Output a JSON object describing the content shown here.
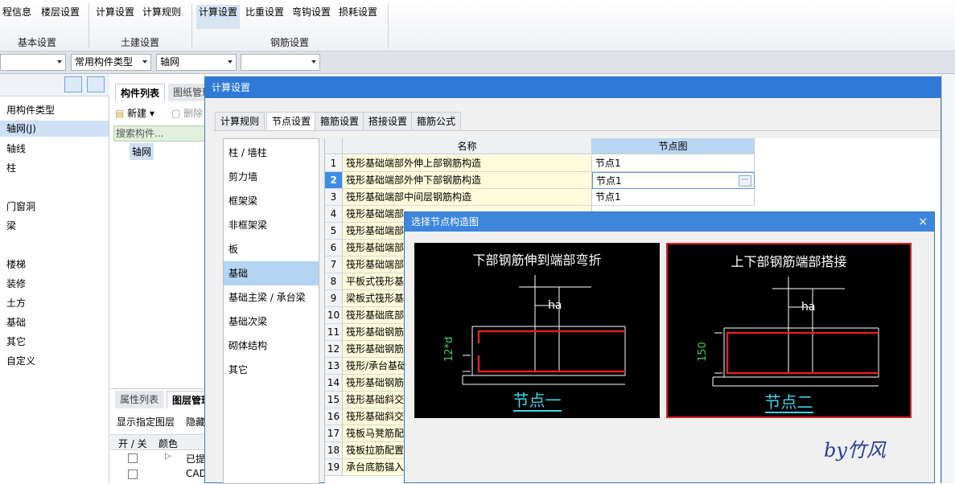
{
  "ribbon": {
    "tabs": [
      "程信息",
      "楼层设置",
      "计算设置",
      "计算规则",
      "计算设置",
      "比重设置",
      "弯钩设置",
      "损耗设置"
    ],
    "groups": [
      "基本设置",
      "土建设置",
      "钢筋设置"
    ]
  },
  "combos": [
    {
      "value": ""
    },
    {
      "value": "常用构件类型"
    },
    {
      "value": "轴网"
    },
    {
      "value": ""
    }
  ],
  "left_tree": {
    "items": [
      "用构件类型",
      "轴网(J)",
      "轴线",
      "柱",
      "门窗洞",
      "梁",
      "楼梯",
      "装修",
      "土方",
      "基础",
      "其它",
      "自定义"
    ],
    "selected_index": 1
  },
  "mid_panel": {
    "tabs": [
      "构件列表",
      "图纸管理"
    ],
    "new_label": "新建",
    "delete_label": "删除",
    "search_placeholder": "搜索构件...",
    "item": "轴网",
    "bottom_tabs": [
      "属性列表",
      "图层管理"
    ],
    "show_layer": "显示指定图层",
    "hide_label": "隐藏",
    "col_onoff": "开 / 关",
    "col_color": "颜色",
    "row1": "已提",
    "row2": "CAD"
  },
  "dialog": {
    "title": "计算设置",
    "tabs": [
      "计算规则",
      "节点设置",
      "箍筋设置",
      "搭接设置",
      "箍筋公式"
    ],
    "active_tab": 1,
    "categories": [
      "柱 / 墙柱",
      "剪力墙",
      "框架梁",
      "非框架梁",
      "板",
      "基础",
      "基础主梁 / 承台梁",
      "基础次梁",
      "砌体结构",
      "其它"
    ],
    "selected_category": 5,
    "grid": {
      "col_name": "名称",
      "col_node": "节点图",
      "rows": [
        {
          "n": "1",
          "name": "筏形基础端部外伸上部钢筋构造",
          "val": "节点1"
        },
        {
          "n": "2",
          "name": "筏形基础端部外伸下部钢筋构造",
          "val": "节点1"
        },
        {
          "n": "3",
          "name": "筏形基础端部中间层钢筋构造",
          "val": "节点1"
        },
        {
          "n": "4",
          "name": "筏形基础端部",
          "val": ""
        },
        {
          "n": "5",
          "name": "筏形基础端部",
          "val": ""
        },
        {
          "n": "6",
          "name": "筏形基础端部",
          "val": ""
        },
        {
          "n": "7",
          "name": "筏形基础端部",
          "val": ""
        },
        {
          "n": "8",
          "name": "平板式筏形基",
          "val": ""
        },
        {
          "n": "9",
          "name": "梁板式筏形基",
          "val": ""
        },
        {
          "n": "10",
          "name": "筏形基础底部",
          "val": ""
        },
        {
          "n": "11",
          "name": "筏形基础钢筋",
          "val": ""
        },
        {
          "n": "12",
          "name": "筏形基础钢筋",
          "val": ""
        },
        {
          "n": "13",
          "name": "筏形/承台基础",
          "val": ""
        },
        {
          "n": "14",
          "name": "筏形基础钢筋",
          "val": ""
        },
        {
          "n": "15",
          "name": "筏形基础斜交",
          "val": ""
        },
        {
          "n": "16",
          "name": "筏形基础斜交",
          "val": ""
        },
        {
          "n": "17",
          "name": "筏板马凳筋配",
          "val": ""
        },
        {
          "n": "18",
          "name": "筏板拉筋配置",
          "val": ""
        },
        {
          "n": "19",
          "name": "承台底筋锚入",
          "val": ""
        }
      ],
      "selected_row": 1
    }
  },
  "node_dialog": {
    "title": "选择节点构造图",
    "close": "×",
    "panels": [
      {
        "title": "下部钢筋伸到端部弯折",
        "ha": "ha",
        "dim": "12*d",
        "label": "节点一"
      },
      {
        "title": "上下部钢筋端部搭接",
        "ha": "ha",
        "dim": "150",
        "label": "节点二"
      }
    ],
    "selected_panel": 1
  },
  "signature": "by竹风",
  "colors": {
    "accent": "#2f7ad6",
    "selected_border": "#e02020",
    "node_label": "#3ed4e8"
  }
}
